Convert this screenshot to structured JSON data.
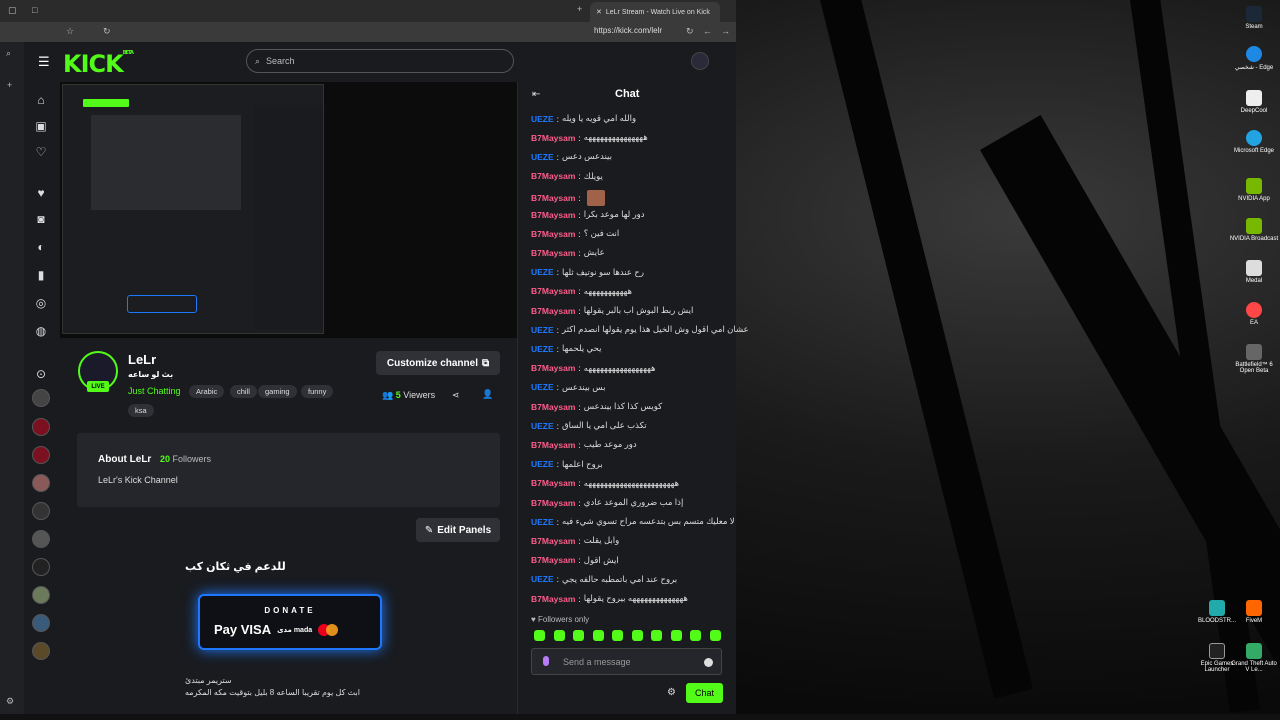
{
  "browser": {
    "tab_title": "LeLr Stream - Watch Live on Kick",
    "url": "https://kick.com/lelr"
  },
  "header": {
    "logo": "KICK",
    "logo_beta": "BETA",
    "search_placeholder": "Search"
  },
  "stream": {
    "streamer_name": "LeLr",
    "subtitle": "بث لو ساعه",
    "live_badge": "LIVE",
    "category": "Just Chatting",
    "tags": [
      "Arabic",
      "chill",
      "gaming",
      "funny",
      "ksa"
    ],
    "customize_label": "Customize channel",
    "viewers_count": "5",
    "viewers_label": "Viewers"
  },
  "about": {
    "title": "About LeLr",
    "followers_count": "20",
    "followers_label": "Followers",
    "description": "LeLr's Kick Channel"
  },
  "panels": {
    "edit_label": "Edit Panels",
    "title": "للدعم في ثكان كب",
    "donate_label": "DONATE",
    "pay_text": "Pay VISA",
    "mada_text": "مدى mada",
    "line1": "ستريمر مبتدئ",
    "line2": "ابث كل يوم تقريبا الساعه 8 بليل بتوقيت مكه المكرمه"
  },
  "chat": {
    "title": "Chat",
    "messages": [
      {
        "user": "UEZE",
        "text": "والله امي قويه يا ويله"
      },
      {
        "user": "B7Maysam",
        "text": "هههههههههههههههه"
      },
      {
        "user": "UEZE",
        "text": "بيندعس دعس"
      },
      {
        "user": "B7Maysam",
        "text": "يويلك"
      },
      {
        "user": "B7Maysam",
        "text": ""
      },
      {
        "user": "B7Maysam",
        "text": "دور لها موعد بكرا"
      },
      {
        "user": "B7Maysam",
        "text": "انت فين ؟"
      },
      {
        "user": "B7Maysam",
        "text": "عايش"
      },
      {
        "user": "UEZE",
        "text": "رح عندها سو نوتيف ثلها"
      },
      {
        "user": "B7Maysam",
        "text": "هههههههههههه"
      },
      {
        "user": "B7Maysam",
        "text": "ايش ربط البوش اب بالبر يقولها"
      },
      {
        "user": "UEZE",
        "text": "عشان امي اقول وش الخيل هذا يوم يقولها انصدم اكثر"
      },
      {
        "user": "UEZE",
        "text": "يحي يلحمها"
      },
      {
        "user": "B7Maysam",
        "text": "هههههههههههههههههه"
      },
      {
        "user": "UEZE",
        "text": "بس بيندعس"
      },
      {
        "user": "B7Maysam",
        "text": "كويس كذا كذا بيندعس"
      },
      {
        "user": "UEZE",
        "text": "تكذب على امي يا الساق"
      },
      {
        "user": "B7Maysam",
        "text": "دور موعد طيب"
      },
      {
        "user": "UEZE",
        "text": "بروح اعلمها"
      },
      {
        "user": "B7Maysam",
        "text": "هههههههههههههههههههههههه"
      },
      {
        "user": "B7Maysam",
        "text": "إذا مب ضروري الموعد عادي"
      },
      {
        "user": "UEZE",
        "text": "لا معليك متسم بس بتدعسه مراح تسوي شيء فيه"
      },
      {
        "user": "B7Maysam",
        "text": "وابل يقلت"
      },
      {
        "user": "B7Maysam",
        "text": "ايش اقول"
      },
      {
        "user": "UEZE",
        "text": "بروح عند امي باتمطبه حالفه يجي"
      },
      {
        "user": "B7Maysam",
        "text": "ههههههههههههههه بيروح يقولها"
      }
    ],
    "followers_only": "Followers only",
    "input_placeholder": "Send a message",
    "send_label": "Chat"
  },
  "colors": {
    "accent": "#53fc18",
    "ueze": "#1e78ff",
    "b7maysam": "#ff5c8a"
  },
  "desktop_icons": [
    "Steam",
    "شخصي - Edge",
    "DeepCool",
    "Microsoft Edge",
    "NVIDIA App",
    "NVIDIA Broadcast",
    "Medal",
    "EA",
    "Battlefield™ 6 Open Beta",
    "BLOODSTR...",
    "FiveM",
    "Epic Games Launcher",
    "Grand Theft Auto V Le..."
  ]
}
